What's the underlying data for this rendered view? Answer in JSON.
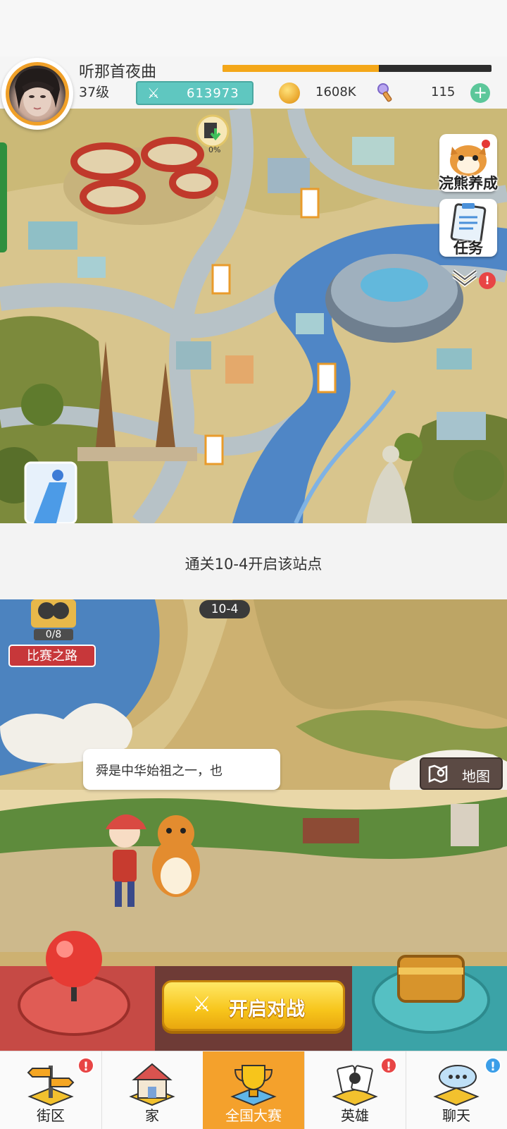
{
  "player": {
    "name": "听那首夜曲",
    "level": "37级",
    "xp_progress": 0.58,
    "power": "613973"
  },
  "currency": {
    "coins": "1608K",
    "gems": "115",
    "add_icon": "plus-icon"
  },
  "map": {
    "raccoon_care_label": "浣熊养成",
    "tasks_label": "任务",
    "building_progress": "0%"
  },
  "notice": {
    "unlock_text": "通关10-4开启该站点"
  },
  "stage": {
    "current": "10-4",
    "match_progress": "0/8",
    "match_road_label": "比赛之路",
    "dialogue": "舜是中华始祖之一，也",
    "map_button_label": "地图",
    "start_battle_label": "开启对战"
  },
  "bottom_nav": {
    "items": [
      {
        "label": "街区",
        "icon": "street-signpost-icon",
        "badge": "!",
        "badge_color": "#e84545"
      },
      {
        "label": "家",
        "icon": "house-icon",
        "badge": "",
        "badge_color": ""
      },
      {
        "label": "全国大赛",
        "icon": "trophy-icon",
        "badge": "",
        "badge_color": "",
        "active": true
      },
      {
        "label": "英雄",
        "icon": "hero-cards-icon",
        "badge": "!",
        "badge_color": "#e84545"
      },
      {
        "label": "聊天",
        "icon": "chat-bubbles-icon",
        "badge": "!",
        "badge_color": "#3b9ee8"
      }
    ]
  },
  "colors": {
    "accent_orange": "#f4a12c",
    "power_teal": "#5fc7c0",
    "start_yellow": "#f7c51b",
    "badge_red": "#e84545"
  }
}
